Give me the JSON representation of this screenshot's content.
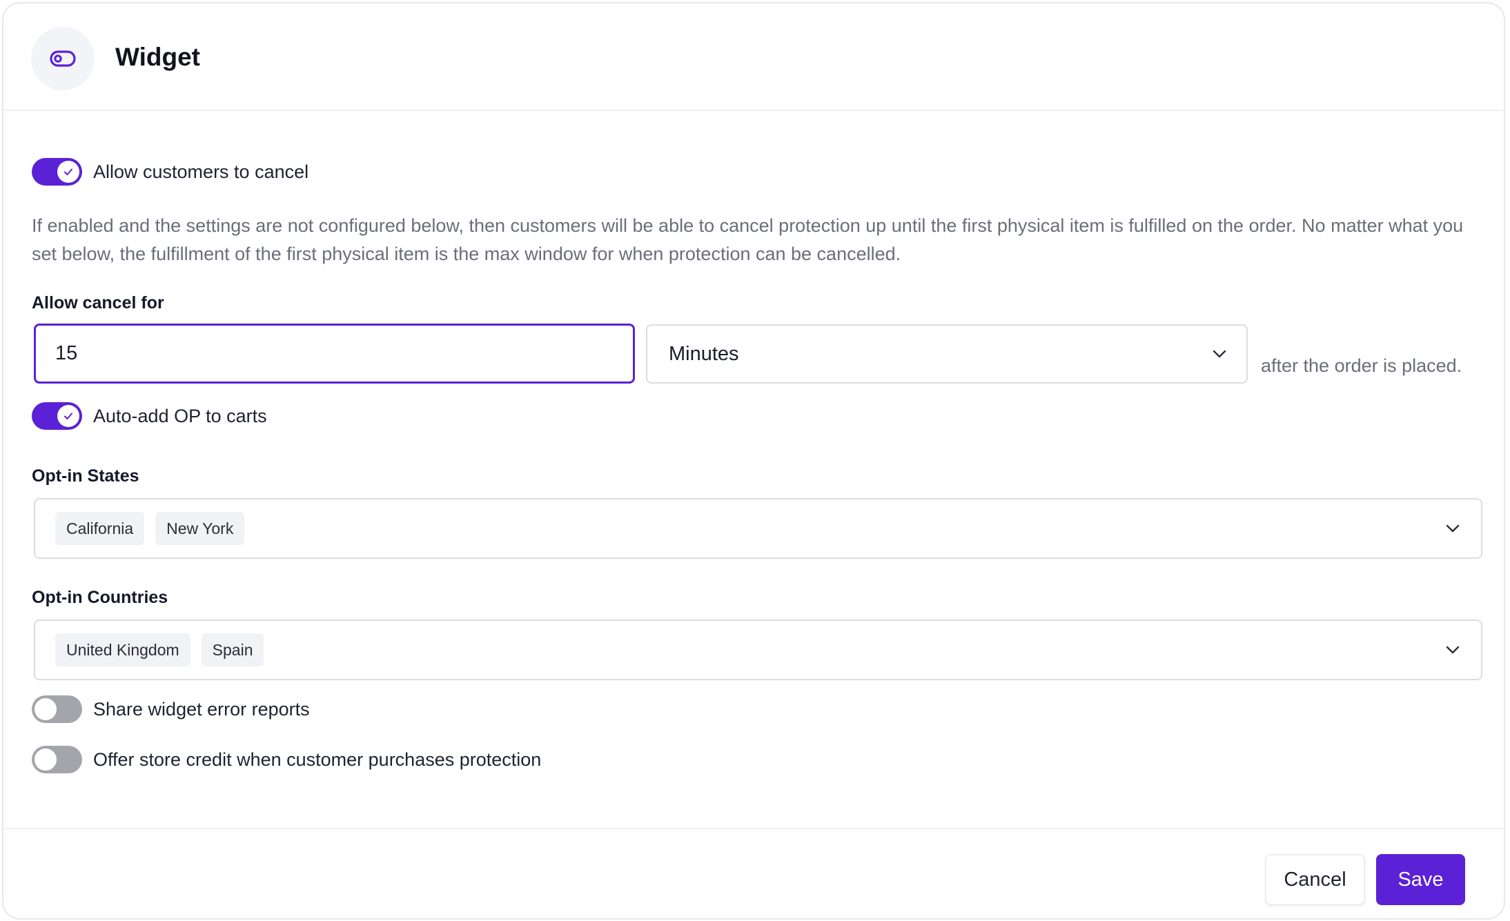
{
  "header": {
    "title": "Widget",
    "icon": "toggle-icon"
  },
  "colors": {
    "accent": "#5b21d6",
    "toggle_off": "#a3a5aa",
    "muted_text": "#6b6e78"
  },
  "allow_cancel": {
    "toggle_on": true,
    "label": "Allow customers to cancel",
    "help": "If enabled and the settings are not configured below, then customers will be able to cancel protection up until the first physical item is fulfilled on the order. No matter what you set below, the fulfillment of the first physical item is the max window for when protection can be cancelled."
  },
  "allow_cancel_for": {
    "label": "Allow cancel for",
    "value": "15",
    "unit_selected": "Minutes",
    "suffix": "after the order is placed."
  },
  "auto_add": {
    "toggle_on": true,
    "label": "Auto-add OP to carts"
  },
  "opt_in_states": {
    "label": "Opt-in States",
    "chips": [
      "California",
      "New York"
    ]
  },
  "opt_in_countries": {
    "label": "Opt-in Countries",
    "chips": [
      "United Kingdom",
      "Spain"
    ]
  },
  "share_errors": {
    "toggle_on": false,
    "label": "Share widget error reports"
  },
  "store_credit": {
    "toggle_on": false,
    "label": "Offer store credit when customer purchases protection"
  },
  "footer": {
    "cancel_label": "Cancel",
    "save_label": "Save"
  }
}
